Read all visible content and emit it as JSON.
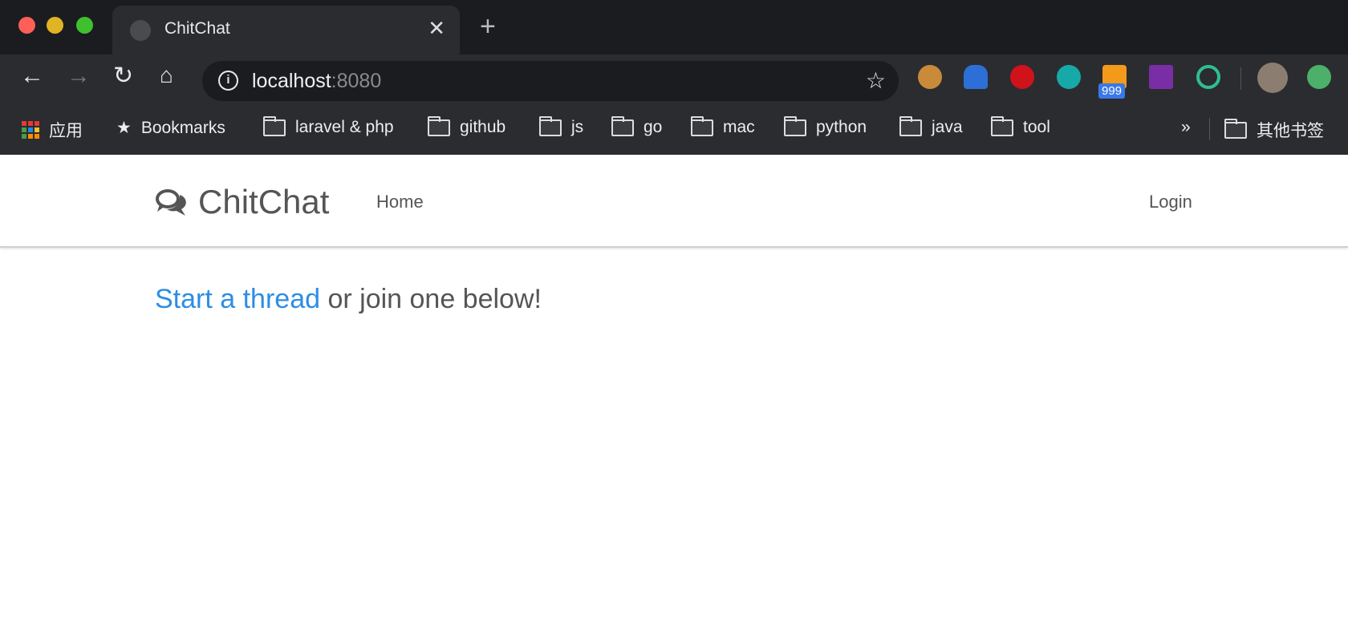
{
  "browser": {
    "tab_title": "ChitChat",
    "url_host": "localhost",
    "url_port": ":8080",
    "extension_badge": "999",
    "bookmarks": [
      "应用",
      "Bookmarks",
      "laravel & php",
      "github",
      "js",
      "go",
      "mac",
      "python",
      "java",
      "tool"
    ],
    "overflow": "»",
    "other_bookmarks": "其他书签"
  },
  "site": {
    "brand": "ChitChat",
    "nav_home": "Home",
    "nav_login": "Login",
    "start_link": "Start a thread",
    "start_rest": " or join one below!",
    "link_color": "#2d8de4"
  }
}
